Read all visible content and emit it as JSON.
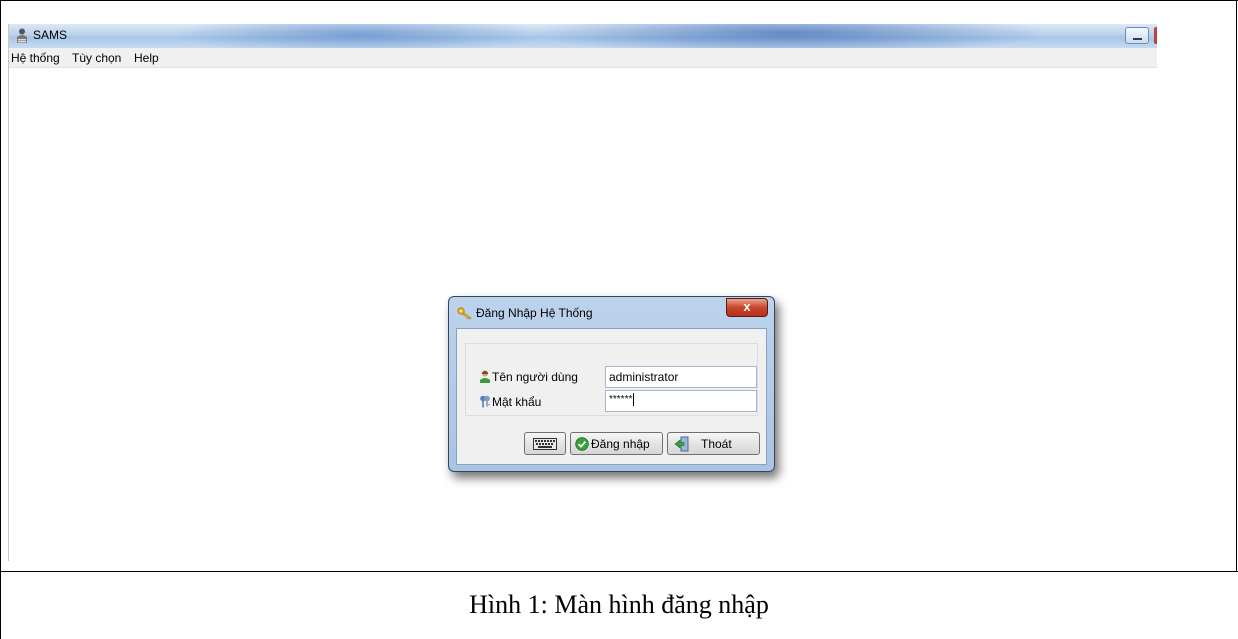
{
  "window": {
    "title": "SAMS",
    "icon": "database-person-icon"
  },
  "menu": {
    "items": [
      "Hệ thống",
      "Tùy chọn",
      "Help"
    ]
  },
  "dialog": {
    "title": "Đăng Nhập Hệ Thống",
    "icon": "key-icon",
    "close_label": "x",
    "username": {
      "label": "Tên người dùng",
      "value": "administrator",
      "icon": "user-icon"
    },
    "password": {
      "label": "Mật khẩu",
      "value": "******",
      "icon": "keys-icon"
    },
    "buttons": {
      "keyboard_icon": "keyboard-icon",
      "login_label": "Đăng nhập",
      "login_icon": "check-circle-icon",
      "exit_label": "Thoát",
      "exit_icon": "exit-door-icon"
    }
  },
  "caption": "Hình 1: Màn hình đăng nhập",
  "colors": {
    "title_bar": "#b9d1ec",
    "dialog_frame": "#a9c4e3",
    "close_button": "#c9452c"
  }
}
